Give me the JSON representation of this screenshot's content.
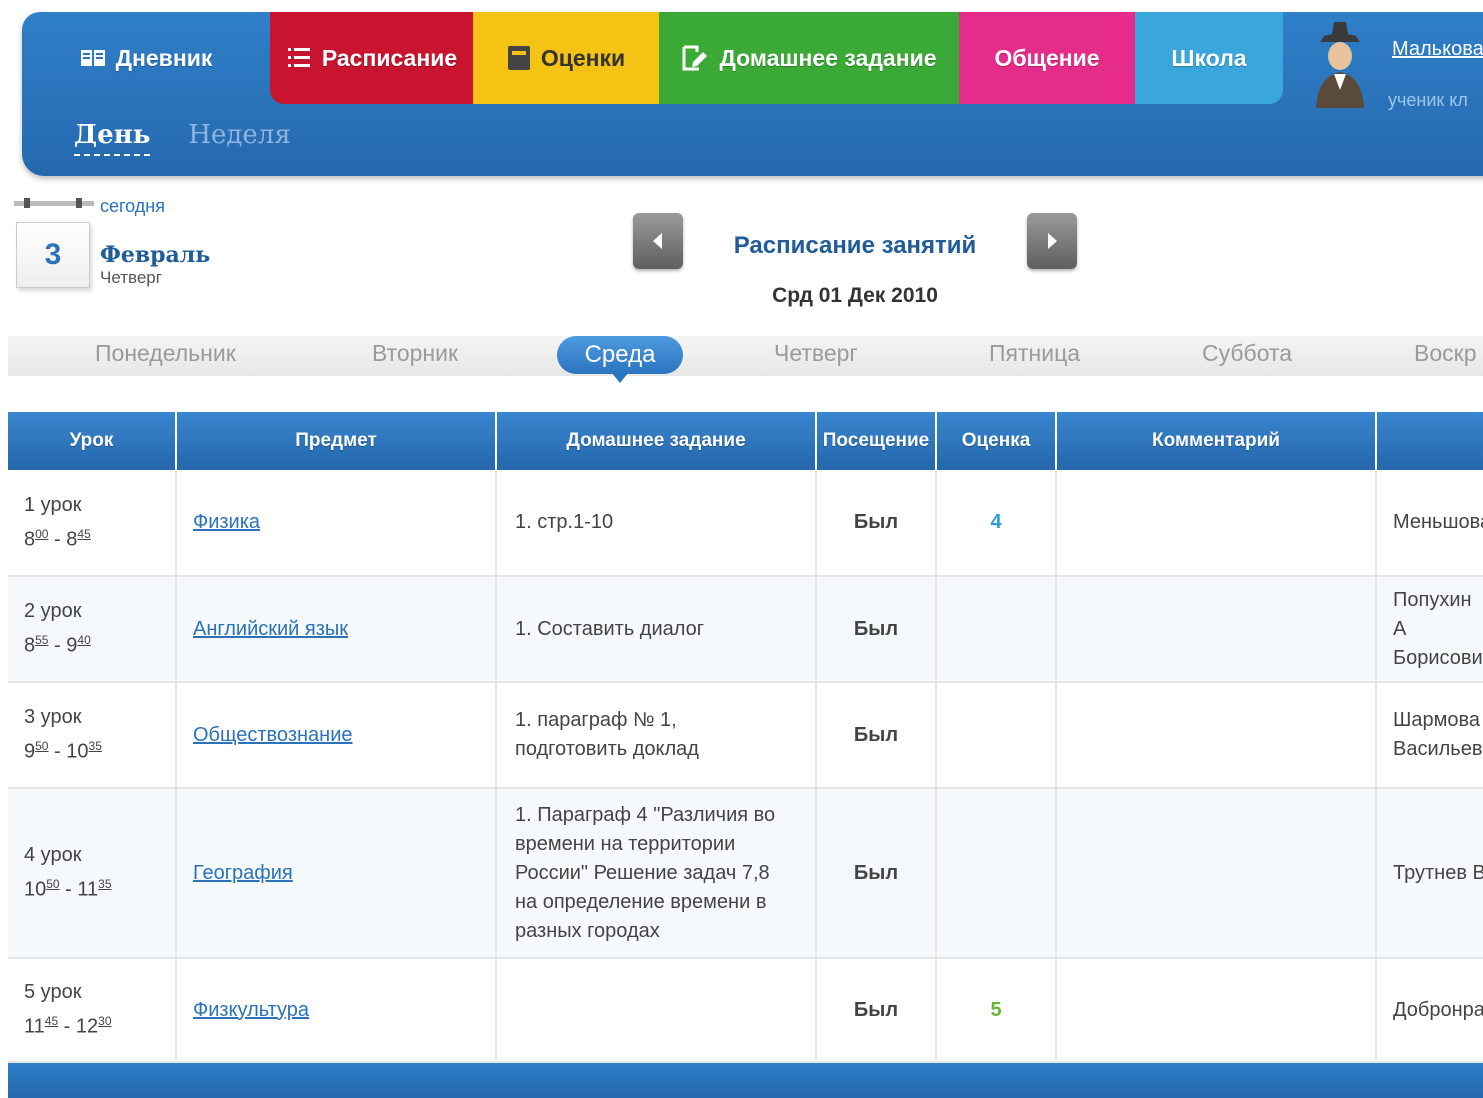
{
  "nav": [
    {
      "label": "Дневник",
      "icon": "book-icon"
    },
    {
      "label": "Расписание",
      "icon": "list-icon"
    },
    {
      "label": "Оценки",
      "icon": "notebook-icon"
    },
    {
      "label": "Домашнее задание",
      "icon": "edit-icon"
    },
    {
      "label": "Общение",
      "icon": ""
    },
    {
      "label": "Школа",
      "icon": ""
    }
  ],
  "user": {
    "name": "Малькова",
    "role": "ученик кл"
  },
  "subtabs": {
    "day": "День",
    "week": "Неделя"
  },
  "calendar": {
    "today_label": "сегодня",
    "day": "3",
    "month": "Февраль",
    "weekday": "Четверг"
  },
  "schedule": {
    "title": "Расписание занятий",
    "date": "Срд 01 Дек 2010"
  },
  "weekdays": {
    "mon": "Понедельник",
    "tue": "Вторник",
    "wed": "Среда",
    "thu": "Четверг",
    "fri": "Пятница",
    "sat": "Суббота",
    "sun": "Воскр"
  },
  "table": {
    "headers": [
      "Урок",
      "Предмет",
      "Домашнее задание",
      "Посещение",
      "Оценка",
      "Комментарий",
      ""
    ],
    "rows": [
      {
        "num": "1 урок",
        "t1h": "8",
        "t1m": "00",
        "t2h": "8",
        "t2m": "45",
        "subject": "Физика",
        "hw": "1. стр.1-10",
        "att": "Был",
        "mark": "4",
        "comment": "",
        "teacher": "Меньшова"
      },
      {
        "num": "2 урок",
        "t1h": "8",
        "t1m": "55",
        "t2h": "9",
        "t2m": "40",
        "subject": "Английский язык",
        "hw": "1. Составить диалог",
        "att": "Был",
        "mark": "",
        "comment": "",
        "teacher": "Попухин А\nБорисови"
      },
      {
        "num": "3 урок",
        "t1h": "9",
        "t1m": "50",
        "t2h": "10",
        "t2m": "35",
        "subject": "Обществознание",
        "hw": "1. параграф № 1,\nподготовить доклад",
        "att": "Был",
        "mark": "",
        "comment": "",
        "teacher": "Шармова\nВасильев"
      },
      {
        "num": "4 урок",
        "t1h": "10",
        "t1m": "50",
        "t2h": "11",
        "t2m": "35",
        "subject": "География",
        "hw": "1. Параграф 4 \"Различия во\nвремени на территории\nРоссии\" Решение задач 7,8\nна определение времени в\nразных городах",
        "att": "Был",
        "mark": "",
        "comment": "",
        "teacher": "Трутнев В"
      },
      {
        "num": "5 урок",
        "t1h": "11",
        "t1m": "45",
        "t2h": "12",
        "t2m": "30",
        "subject": "Физкультура",
        "hw": "",
        "att": "Был",
        "mark": "5",
        "comment": "",
        "teacher": "Добронра"
      }
    ]
  },
  "colors": {
    "mark_4": "#2a9fd6",
    "mark_5": "#6cb534"
  }
}
